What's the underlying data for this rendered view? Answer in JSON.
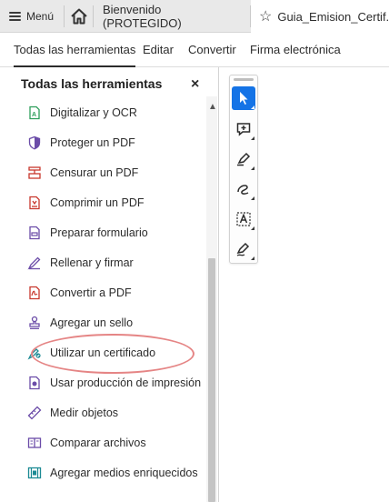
{
  "tabbar": {
    "menu_label": "Menú",
    "welcome_tab": "Bienvenido (PROTEGIDO)",
    "doc_tab": "Guia_Emision_Certif..."
  },
  "subtabs": [
    {
      "label": "Todas las herramientas",
      "active": true
    },
    {
      "label": "Editar",
      "active": false
    },
    {
      "label": "Convertir",
      "active": false
    },
    {
      "label": "Firma electrónica",
      "active": false
    }
  ],
  "panel": {
    "title": "Todas las herramientas",
    "close_symbol": "×",
    "tools": [
      {
        "label": "Digitalizar y OCR",
        "icon": "scan-ocr-icon"
      },
      {
        "label": "Proteger un PDF",
        "icon": "protect-pdf-icon"
      },
      {
        "label": "Censurar un PDF",
        "icon": "redact-pdf-icon"
      },
      {
        "label": "Comprimir un PDF",
        "icon": "compress-pdf-icon"
      },
      {
        "label": "Preparar formulario",
        "icon": "prepare-form-icon"
      },
      {
        "label": "Rellenar y firmar",
        "icon": "fill-sign-icon"
      },
      {
        "label": "Convertir a PDF",
        "icon": "convert-pdf-icon"
      },
      {
        "label": "Agregar un sello",
        "icon": "stamp-icon"
      },
      {
        "label": "Utilizar un certificado",
        "icon": "certificate-icon"
      },
      {
        "label": "Usar producción de impresión",
        "icon": "print-production-icon"
      },
      {
        "label": "Medir objetos",
        "icon": "measure-icon"
      },
      {
        "label": "Comparar archivos",
        "icon": "compare-files-icon"
      },
      {
        "label": "Agregar medios enriquecidos",
        "icon": "rich-media-icon"
      }
    ]
  },
  "vertical_tools": [
    {
      "icon": "select-pointer-icon",
      "active": true
    },
    {
      "icon": "add-comment-icon",
      "active": false
    },
    {
      "icon": "highlight-pen-icon",
      "active": false
    },
    {
      "icon": "draw-freehand-icon",
      "active": false
    },
    {
      "icon": "text-box-icon",
      "active": false
    },
    {
      "icon": "sign-icon",
      "active": false
    }
  ],
  "colors": {
    "accent": "#1473e6",
    "highlight_ring": "#e58585",
    "icon_purple": "#6b4ca8",
    "icon_red": "#c8372d",
    "icon_green": "#2e9e5b",
    "icon_teal": "#1c8a94"
  }
}
